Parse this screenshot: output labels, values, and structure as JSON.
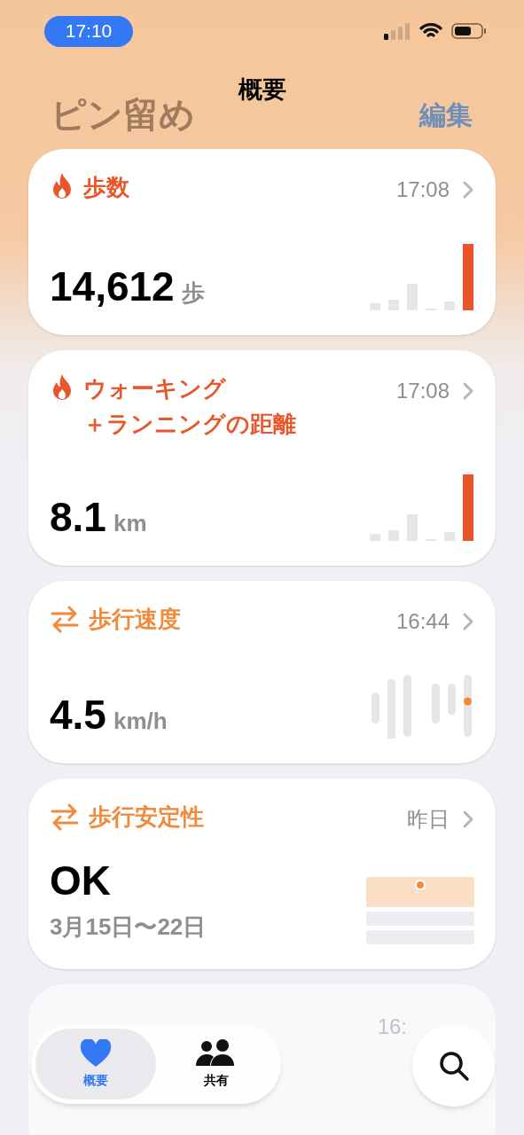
{
  "status_bar": {
    "time": "17:10"
  },
  "header": {
    "title": "概要",
    "large_title": "ピン留め",
    "edit": "編集"
  },
  "cards": [
    {
      "kind": "bars",
      "icon": {
        "kind": "flame",
        "color": "#e8562a"
      },
      "title_lines": [
        "歩数"
      ],
      "time": "17:08",
      "value": "14,612",
      "unit": "歩"
    },
    {
      "kind": "bars",
      "icon": {
        "kind": "flame",
        "color": "#e8562a"
      },
      "title_lines": [
        "ウォーキング",
        "＋ランニングの距離"
      ],
      "time": "17:08",
      "value": "8.1",
      "unit": "km"
    },
    {
      "kind": "range",
      "icon": {
        "kind": "arrows",
        "color": "#f08a3c"
      },
      "title_lines": [
        "歩行速度"
      ],
      "time": "16:44",
      "value": "4.5",
      "unit": "km/h"
    },
    {
      "kind": "stability",
      "icon": {
        "kind": "arrows",
        "color": "#f08a3c"
      },
      "title_lines": [
        "歩行安定性"
      ],
      "time": "昨日",
      "value": "OK",
      "subtitle": "3月15日〜22日"
    },
    {
      "kind": "partial",
      "time": "16:"
    }
  ],
  "tab_bar": {
    "tabs": [
      {
        "label": "概要",
        "selected": true
      },
      {
        "label": "共有",
        "selected": false
      }
    ]
  }
}
